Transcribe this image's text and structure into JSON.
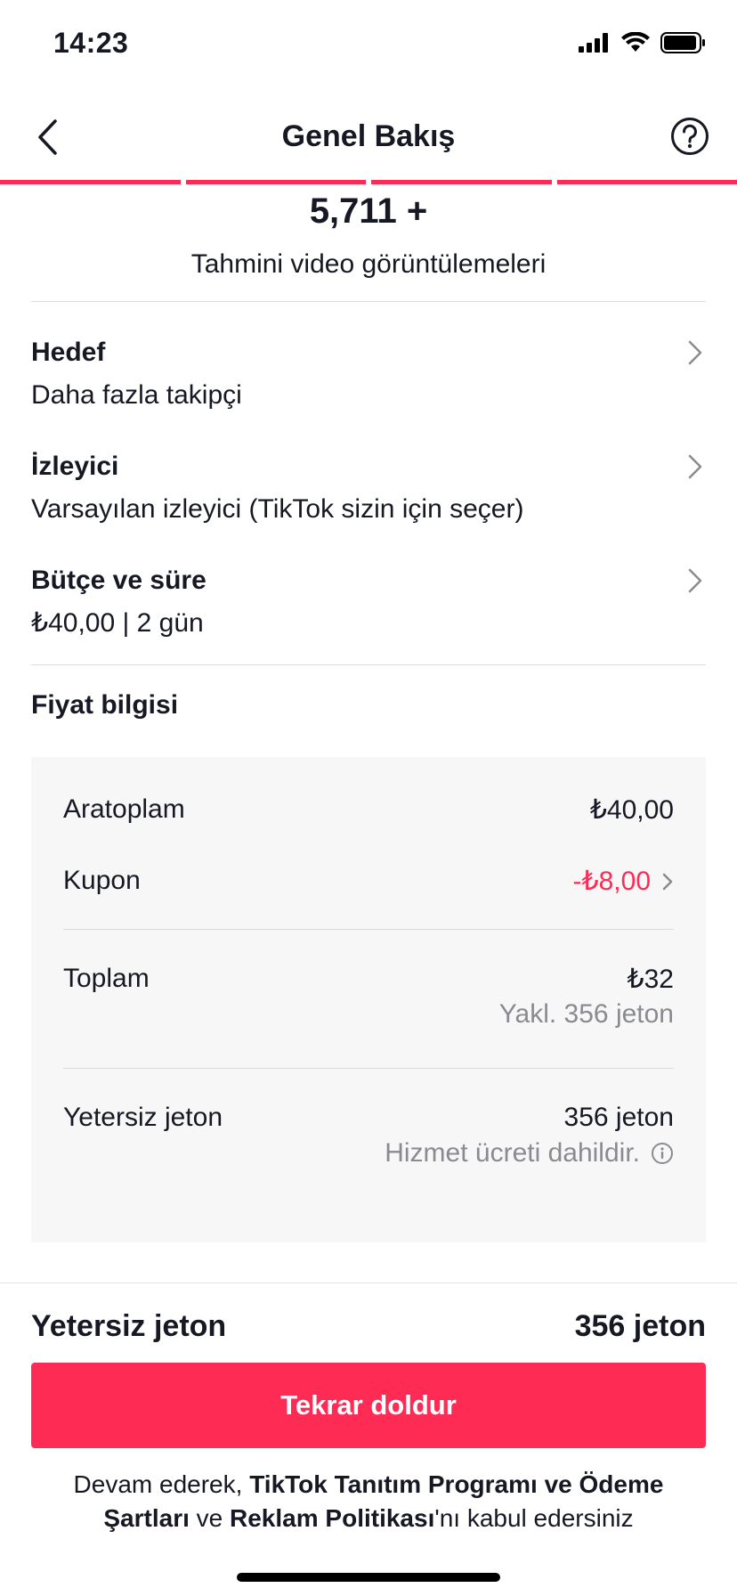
{
  "status_bar": {
    "time": "14:23"
  },
  "nav": {
    "title": "Genel Bakış"
  },
  "progress": {
    "steps_total": 4,
    "steps_completed": 4
  },
  "estimate": {
    "value": "5,711 +",
    "label": "Tahmini video görüntülemeleri"
  },
  "settings": [
    {
      "title": "Hedef",
      "value": "Daha fazla takipçi"
    },
    {
      "title": "İzleyici",
      "value": "Varsayılan izleyici (TikTok sizin için seçer)"
    },
    {
      "title": "Bütçe ve süre",
      "value": "₺40,00 | 2 gün"
    }
  ],
  "price": {
    "title": "Fiyat bilgisi",
    "subtotal_label": "Aratoplam",
    "subtotal_value": "₺40,00",
    "coupon_label": "Kupon",
    "coupon_value": "-₺8,00",
    "total_label": "Toplam",
    "total_value": "₺32",
    "total_note": "Yakl. 356 jeton",
    "insufficient_label": "Yetersiz jeton",
    "insufficient_value": "356 jeton",
    "insufficient_note": "Hizmet ücreti dahildir."
  },
  "footer": {
    "label": "Yetersiz jeton",
    "value": "356 jeton",
    "cta": "Tekrar doldur",
    "terms_prefix": "Devam ederek, ",
    "terms_link1": "TikTok Tanıtım Programı ve Ödeme Şartları",
    "terms_mid": " ve ",
    "terms_link2": "Reklam Politikası",
    "terms_suffix": "'nı kabul edersiniz"
  },
  "colors": {
    "accent": "#fe2c55",
    "text": "#161823",
    "muted": "#8a8b91",
    "panel": "#f7f7f8"
  }
}
